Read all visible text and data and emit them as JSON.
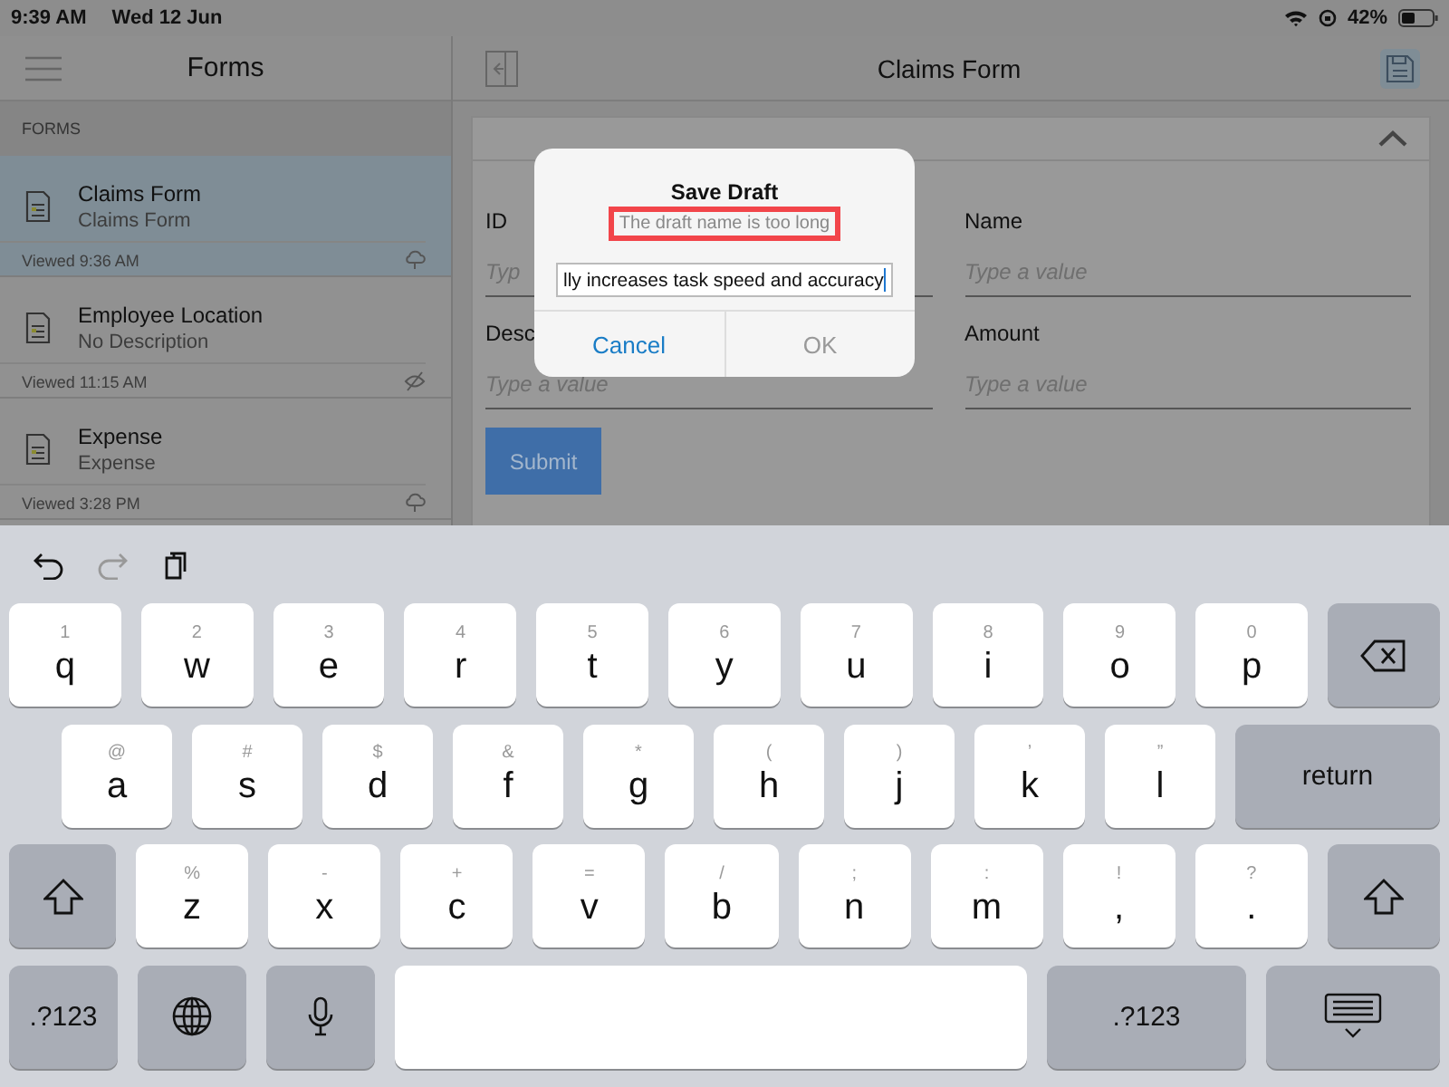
{
  "status_bar": {
    "time": "9:39 AM",
    "date": "Wed 12 Jun",
    "battery": "42%"
  },
  "sidebar": {
    "title": "Forms",
    "section": "FORMS",
    "items": [
      {
        "title": "Claims Form",
        "subtitle": "Claims Form",
        "viewed": "Viewed 9:36 AM",
        "selected": true,
        "kind": "cloud"
      },
      {
        "title": "Employee Location",
        "subtitle": "No Description",
        "viewed": "Viewed 11:15 AM",
        "selected": false,
        "kind": "hidden"
      },
      {
        "title": "Expense",
        "subtitle": "Expense",
        "viewed": "Viewed 3:28 PM",
        "selected": false,
        "kind": "cloud"
      }
    ]
  },
  "form": {
    "title": "Claims Form",
    "fields": [
      {
        "label": "ID",
        "placeholder": "Typ"
      },
      {
        "label": "Name",
        "placeholder": "Type a value"
      },
      {
        "label": "Desc",
        "placeholder": "Type a value"
      },
      {
        "label": "Amount",
        "placeholder": "Type a value"
      }
    ],
    "submit": "Submit"
  },
  "dialog": {
    "title": "Save Draft",
    "error": "The draft name is too long",
    "value": "lly increases task speed and accuracy",
    "buttons": [
      {
        "label": "Cancel",
        "disabled": false
      },
      {
        "label": "OK",
        "disabled": true
      }
    ]
  },
  "keyboard": {
    "toolbar": [
      {
        "kind": "undo",
        "disabled": false
      },
      {
        "kind": "redo",
        "disabled": true
      },
      {
        "kind": "paste",
        "disabled": false
      }
    ],
    "rows": [
      {
        "keys": [
          {
            "kind": "letter",
            "label": "q",
            "hint": "1"
          },
          {
            "kind": "letter",
            "label": "w",
            "hint": "2"
          },
          {
            "kind": "letter",
            "label": "e",
            "hint": "3"
          },
          {
            "kind": "letter",
            "label": "r",
            "hint": "4"
          },
          {
            "kind": "letter",
            "label": "t",
            "hint": "5"
          },
          {
            "kind": "letter",
            "label": "y",
            "hint": "6"
          },
          {
            "kind": "letter",
            "label": "u",
            "hint": "7"
          },
          {
            "kind": "letter",
            "label": "i",
            "hint": "8"
          },
          {
            "kind": "letter",
            "label": "o",
            "hint": "9"
          },
          {
            "kind": "letter",
            "label": "p",
            "hint": "0"
          },
          {
            "kind": "backspace"
          }
        ]
      },
      {
        "keys": [
          {
            "kind": "letter",
            "label": "a",
            "hint": "@"
          },
          {
            "kind": "letter",
            "label": "s",
            "hint": "#"
          },
          {
            "kind": "letter",
            "label": "d",
            "hint": "$"
          },
          {
            "kind": "letter",
            "label": "f",
            "hint": "&"
          },
          {
            "kind": "letter",
            "label": "g",
            "hint": "*"
          },
          {
            "kind": "letter",
            "label": "h",
            "hint": "("
          },
          {
            "kind": "letter",
            "label": "j",
            "hint": ")"
          },
          {
            "kind": "letter",
            "label": "k",
            "hint": "’"
          },
          {
            "kind": "letter",
            "label": "l",
            "hint": "”"
          },
          {
            "kind": "text",
            "label": "return"
          }
        ]
      },
      {
        "keys": [
          {
            "kind": "shift"
          },
          {
            "kind": "letter",
            "label": "z",
            "hint": "%"
          },
          {
            "kind": "letter",
            "label": "x",
            "hint": "-"
          },
          {
            "kind": "letter",
            "label": "c",
            "hint": "+"
          },
          {
            "kind": "letter",
            "label": "v",
            "hint": "="
          },
          {
            "kind": "letter",
            "label": "b",
            "hint": "/"
          },
          {
            "kind": "letter",
            "label": "n",
            "hint": ";"
          },
          {
            "kind": "letter",
            "label": "m",
            "hint": ":"
          },
          {
            "kind": "letter",
            "label": ",",
            "hint": "!"
          },
          {
            "kind": "letter",
            "label": ".",
            "hint": "?"
          },
          {
            "kind": "shift"
          }
        ]
      },
      {
        "keys": [
          {
            "kind": "text",
            "label": ".?123"
          },
          {
            "kind": "globe"
          },
          {
            "kind": "mic"
          },
          {
            "kind": "space"
          },
          {
            "kind": "text",
            "label": ".?123"
          },
          {
            "kind": "hide"
          }
        ]
      }
    ]
  }
}
